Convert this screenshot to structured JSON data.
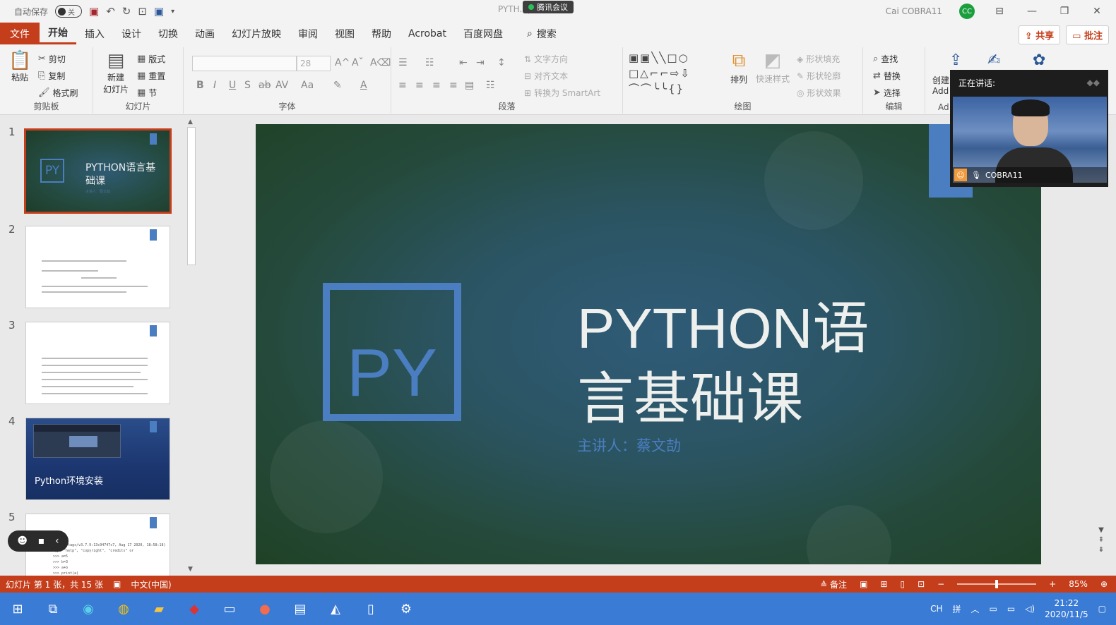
{
  "titlebar": {
    "autosave_label": "自动保存",
    "autosave_state": "关",
    "doc_title": "PYTH...ptx",
    "meeting_badge": "腾讯会议",
    "user_name": "Cai COBRA11",
    "user_initials": "CC",
    "win_icons": [
      "restore-ribbon-icon",
      "minimize-icon",
      "maximize-icon",
      "close-icon"
    ]
  },
  "menu": {
    "file": "文件",
    "tabs": [
      "开始",
      "插入",
      "设计",
      "切换",
      "动画",
      "幻灯片放映",
      "审阅",
      "视图",
      "帮助",
      "Acrobat",
      "百度网盘"
    ],
    "active_tab": "开始",
    "search": "搜索",
    "share": "共享",
    "comment": "批注"
  },
  "ribbon": {
    "clipboard": {
      "paste": "粘贴",
      "cut": "剪切",
      "copy": "复制",
      "format_painter": "格式刷",
      "label": "剪贴板"
    },
    "slides": {
      "new_slide_1": "新建",
      "new_slide_2": "幻灯片",
      "layout": "版式",
      "reset": "重置",
      "section": "节",
      "label": "幻灯片"
    },
    "font": {
      "size": "28",
      "bold": "B",
      "italic": "I",
      "underline": "U",
      "shadow": "S",
      "strike": "ab",
      "spacing": "AV",
      "case": "Aa",
      "label": "字体"
    },
    "paragraph": {
      "text_direction": "文字方向",
      "align_text": "对齐文本",
      "smartart": "转换为 SmartArt",
      "label": "段落"
    },
    "drawing": {
      "arrange": "排列",
      "quick_styles": "快速样式",
      "fill": "形状填充",
      "outline": "形状轮廓",
      "effects": "形状效果",
      "label": "绘图"
    },
    "editing": {
      "find": "查找",
      "replace": "替换",
      "select": "选择",
      "label": "编辑"
    },
    "adobe": {
      "create": "创建",
      "label": "Add",
      "group_label": "Ad"
    }
  },
  "thumbnails": [
    {
      "num": "1",
      "title": "PYTHON语言基础课",
      "sub": "主讲人：蔡文劼",
      "py": "PY"
    },
    {
      "num": "2"
    },
    {
      "num": "3"
    },
    {
      "num": "4",
      "title": "Python环境安装"
    },
    {
      "num": "5",
      "code": "3.7.9 (tags/v3.7.9:13c94747c7, Aug 17 2020, 18:58:18)\nType \"help\", \"copyright\", \"credits\" or\n>>> a=5\n>>> b=3\n>>> a+b\n>>> print(a)"
    }
  ],
  "slide": {
    "py": "PY",
    "title_line1": "PYTHON语",
    "title_line2": "言基础课",
    "subtitle": "主讲人：蔡文劼"
  },
  "video": {
    "speaking": "正在讲话:",
    "name": "COBRA11"
  },
  "status": {
    "slide_info": "幻灯片 第 1 张，共 15 张",
    "language": "中文(中国)",
    "notes": "备注",
    "zoom": "85%",
    "zoom_level": 0.5
  },
  "taskbar": {
    "ime1": "CH",
    "ime2": "拼",
    "time": "21:22",
    "date": "2020/11/5"
  },
  "colors": {
    "accent": "#c43e1c",
    "slide_blue": "#4a7ec0",
    "taskbar": "#3a7bd5"
  }
}
